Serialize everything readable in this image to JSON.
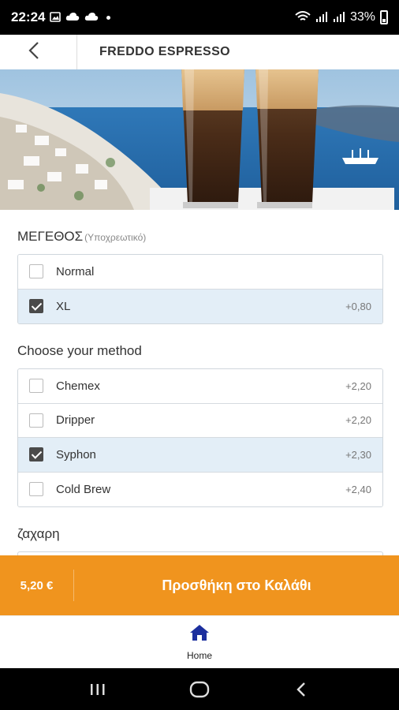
{
  "status_bar": {
    "time": "22:24",
    "battery_percent": "33%"
  },
  "header": {
    "title": "FREDDO ESPRESSO"
  },
  "sections": [
    {
      "title": "ΜΕΓΕΘΟΣ",
      "hint": "(Υποχρεωτικό)",
      "options": [
        {
          "label": "Normal",
          "price": "",
          "selected": false
        },
        {
          "label": "XL",
          "price": "+0,80",
          "selected": true
        }
      ]
    },
    {
      "title": "Choose your method",
      "hint": "",
      "options": [
        {
          "label": "Chemex",
          "price": "+2,20",
          "selected": false
        },
        {
          "label": "Dripper",
          "price": "+2,20",
          "selected": false
        },
        {
          "label": "Syphon",
          "price": "+2,30",
          "selected": true
        },
        {
          "label": "Cold Brew",
          "price": "+2,40",
          "selected": false
        }
      ]
    },
    {
      "title": "ζαχαρη",
      "hint": "",
      "options": []
    }
  ],
  "cart": {
    "total": "5,20 €",
    "action_label": "Προσθήκη στο Καλάθι"
  },
  "bottom_nav": {
    "home_label": "Home"
  },
  "colors": {
    "accent": "#f0941e",
    "selected_row": "#e3eef7",
    "nav_icon": "#1c2f9e"
  }
}
